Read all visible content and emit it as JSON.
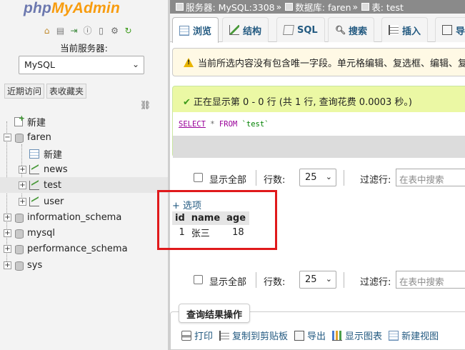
{
  "nav": {
    "logo_php": "php",
    "logo_myadmin": "MyAdmin",
    "icons": [
      "home-icon",
      "database-icon",
      "exit-icon",
      "help-icon",
      "docs-icon",
      "settings-icon",
      "reload-icon"
    ],
    "server_label": "当前服务器:",
    "server_value": "MySQL",
    "tabs": [
      "近期访问",
      "表收藏夹"
    ],
    "tree": {
      "new_root": "新建",
      "db_faren": "faren",
      "new_faren": "新建",
      "table_news": "news",
      "table_test": "test",
      "table_user": "user",
      "db_information_schema": "information_schema",
      "db_mysql": "mysql",
      "db_performance_schema": "performance_schema",
      "db_sys": "sys"
    }
  },
  "breadcrumb": {
    "server": "服务器: MySQL:3308",
    "database": "数据库: faren",
    "table": "表: test",
    "separator": "»"
  },
  "tabs": {
    "browse": "浏览",
    "structure": "结构",
    "sql": "SQL",
    "search": "搜索",
    "insert": "插入",
    "export_partial": "导"
  },
  "notice": {
    "text": "当前所选内容没有包含唯一字段。单元格编辑、复选框、编辑、复"
  },
  "success": {
    "message": "正在显示第 0 - 0 行 (共 1 行, 查询花费 0.0003 秒。)",
    "sql_select": "SELECT",
    "sql_star": "*",
    "sql_from": "FROM",
    "sql_table": "`test`"
  },
  "navrow": {
    "show_all": "显示全部",
    "rows_label": "行数:",
    "rows_value": "25",
    "filter_label": "过滤行:",
    "filter_placeholder": "在表中搜索"
  },
  "results": {
    "options_link": "+ 选项",
    "columns": [
      "id",
      "name",
      "age"
    ],
    "rows": [
      [
        "1",
        "张三",
        "18"
      ]
    ]
  },
  "query_ops": {
    "title": "查询结果操作",
    "print": "打印",
    "copy": "复制到剪贴板",
    "export": "导出",
    "chart": "显示图表",
    "create_view": "新建视图"
  },
  "colors": {
    "highlight": "#e0191b",
    "link": "#235a81",
    "success_bg": "#ebf8a4",
    "notice_bg": "#fff9e5",
    "breadcrumb_bg": "#8a8a8a"
  }
}
